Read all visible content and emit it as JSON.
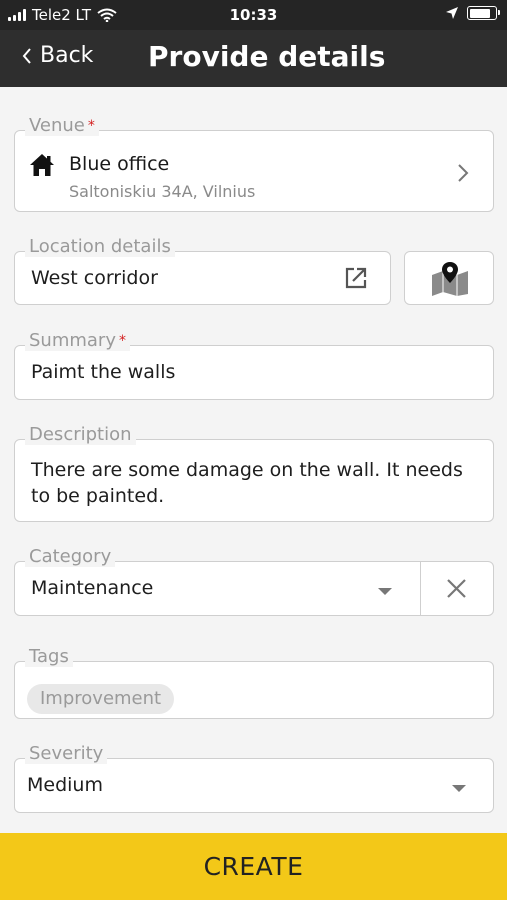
{
  "status_bar": {
    "carrier": "Tele2 LT",
    "time": "10:33",
    "battery_level": 0.8
  },
  "nav": {
    "back_label": "Back",
    "title": "Provide details"
  },
  "form": {
    "venue": {
      "label": "Venue",
      "required_mark": "*",
      "name": "Blue office",
      "address": "Saltoniskiu 34A, Vilnius",
      "icon": "home-icon"
    },
    "location": {
      "label": "Location details",
      "value": "West corridor",
      "icon": "external-link-icon",
      "map_icon": "map-pin-icon"
    },
    "summary": {
      "label": "Summary",
      "required_mark": "*",
      "value": "Paimt the walls"
    },
    "description": {
      "label": "Description",
      "value": "There are some damage on the wall. It needs to be painted."
    },
    "category": {
      "label": "Category",
      "value": "Maintenance"
    },
    "tags": {
      "label": "Tags",
      "items": [
        "Improvement"
      ]
    },
    "severity": {
      "label": "Severity",
      "value": "Medium"
    }
  },
  "actions": {
    "create_label": "CREATE"
  },
  "colors": {
    "accent": "#f3c818",
    "header": "#2e2e2e",
    "required": "#d42020"
  }
}
